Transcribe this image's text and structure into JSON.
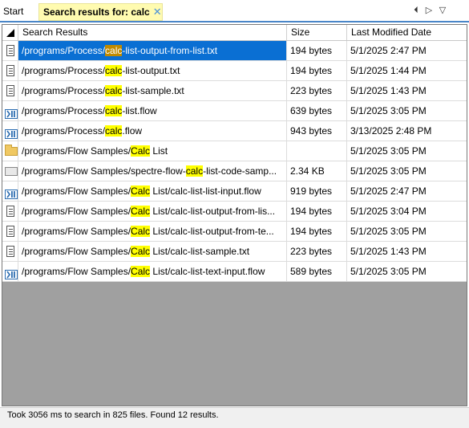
{
  "tabs": {
    "start_label": "Start",
    "search_label": "Search results for: calc",
    "close_glyph": "✕"
  },
  "nav": {
    "prev_glyph": "⏴",
    "next_glyph": "▷",
    "menu_glyph": "▽"
  },
  "table": {
    "columns": [
      "Search Results",
      "Size",
      "Last Modified Date"
    ],
    "sort_indicator": "sort-triangle-icon",
    "rows": [
      {
        "icon": "text-file-icon",
        "prefix": "/programs/Process/",
        "match": "calc",
        "suffix": "-list-output-from-list.txt",
        "size": "194 bytes",
        "date": "5/1/2025 2:47 PM",
        "selected": true
      },
      {
        "icon": "text-file-icon",
        "prefix": "/programs/Process/",
        "match": "calc",
        "suffix": "-list-output.txt",
        "size": "194 bytes",
        "date": "5/1/2025 1:44 PM"
      },
      {
        "icon": "text-file-icon",
        "prefix": "/programs/Process/",
        "match": "calc",
        "suffix": "-list-sample.txt",
        "size": "223 bytes",
        "date": "5/1/2025 1:43 PM"
      },
      {
        "icon": "flow-file-icon",
        "prefix": "/programs/Process/",
        "match": "calc",
        "suffix": "-list.flow",
        "size": "639 bytes",
        "date": "5/1/2025 3:05 PM"
      },
      {
        "icon": "flow-file-icon",
        "prefix": "/programs/Process/",
        "match": "calc",
        "suffix": ".flow",
        "size": "943 bytes",
        "date": "3/13/2025 2:48 PM"
      },
      {
        "icon": "folder-icon",
        "prefix": "/programs/Flow Samples/",
        "match": "Calc",
        "suffix": " List",
        "size": "",
        "date": "5/1/2025 3:05 PM"
      },
      {
        "icon": "code-file-icon",
        "prefix": "/programs/Flow Samples/spectre-flow-",
        "match": "calc",
        "suffix": "-list-code-samp...",
        "size": "2.34 KB",
        "date": "5/1/2025 3:05 PM"
      },
      {
        "icon": "flow-file-icon",
        "prefix": "/programs/Flow Samples/",
        "match": "Calc",
        "suffix": " List/calc-list-list-input.flow",
        "size": "919 bytes",
        "date": "5/1/2025 2:47 PM"
      },
      {
        "icon": "text-file-icon",
        "prefix": "/programs/Flow Samples/",
        "match": "Calc",
        "suffix": " List/calc-list-output-from-lis...",
        "size": "194 bytes",
        "date": "5/1/2025 3:04 PM"
      },
      {
        "icon": "text-file-icon",
        "prefix": "/programs/Flow Samples/",
        "match": "Calc",
        "suffix": " List/calc-list-output-from-te...",
        "size": "194 bytes",
        "date": "5/1/2025 3:05 PM"
      },
      {
        "icon": "text-file-icon",
        "prefix": "/programs/Flow Samples/",
        "match": "Calc",
        "suffix": " List/calc-list-sample.txt",
        "size": "223 bytes",
        "date": "5/1/2025 1:43 PM"
      },
      {
        "icon": "flow-file-icon",
        "prefix": "/programs/Flow Samples/",
        "match": "Calc",
        "suffix": " List/calc-list-text-input.flow",
        "size": "589 bytes",
        "date": "5/1/2025 3:05 PM"
      }
    ]
  },
  "status": {
    "text": "Took 3056 ms to search in 825 files. Found 12 results."
  },
  "colors": {
    "accent": "#0a6fd3",
    "highlight": "#ffff00",
    "selected_highlight": "#c08a00",
    "tab_highlight": "#fffbb0"
  }
}
